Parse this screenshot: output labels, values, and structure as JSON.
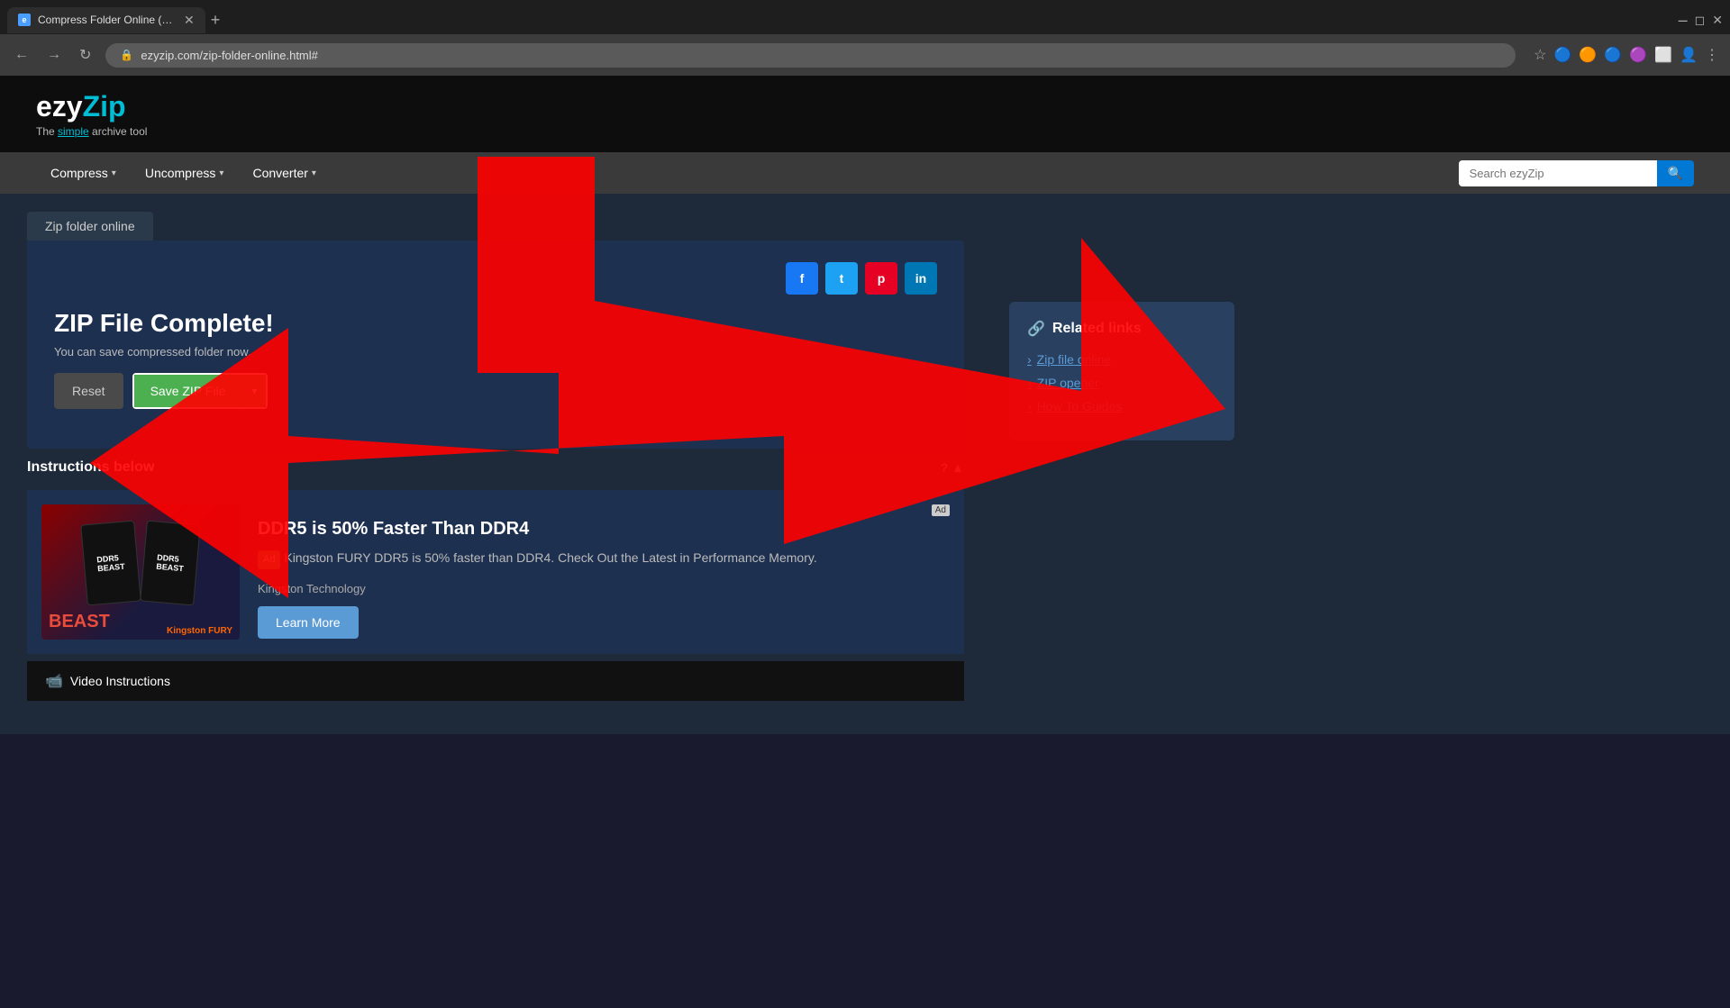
{
  "browser": {
    "tab_title": "Compress Folder Online (No lim...",
    "tab_favicon": "e",
    "url": "ezyzip.com/zip-folder-online.html#",
    "search_placeholder": "Search ezyZip"
  },
  "site": {
    "logo_ezy": "ezy",
    "logo_zip": "Zip",
    "tagline": "The simple archive tool",
    "tagline_simple": "simple"
  },
  "nav": {
    "compress_label": "Compress",
    "uncompress_label": "Uncompress",
    "converter_label": "Converter",
    "search_placeholder": "Search ezyZip"
  },
  "page": {
    "tab_label": "Zip folder online",
    "title": "ZIP File Complete!",
    "subtitle": "You can save compressed folder now.",
    "reset_label": "Reset",
    "save_label": "Save ZIP File",
    "instructions_label": "Instructions below"
  },
  "social": {
    "fb": "f",
    "tw": "t",
    "pt": "p",
    "li": "in"
  },
  "ad": {
    "corner_text": "Ad",
    "title": "DDR5 is 50% Faster Than DDR4",
    "badge_label": "Ad",
    "description": "Kingston FURY DDR5 is 50% faster than DDR4. Check Out the Latest in Performance Memory.",
    "company": "Kingston Technology",
    "learn_more_label": "Learn More"
  },
  "video_section": {
    "label": "Video Instructions"
  },
  "related_links": {
    "title": "Related links",
    "link_icon": "🔗",
    "links": [
      {
        "label": "Zip file online"
      },
      {
        "label": "ZIP opener"
      },
      {
        "label": "How To Guides"
      }
    ]
  }
}
